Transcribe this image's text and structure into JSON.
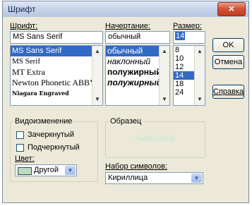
{
  "window": {
    "title": "Шрифт",
    "close_glyph": "×"
  },
  "font": {
    "label": "Шрифт:",
    "value": "MS Sans Serif",
    "items": [
      "MS Sans Serif",
      "MS Serif",
      "MT Extra",
      "Newton Phonetic ABBY",
      "Niagara Engraved"
    ],
    "selected_index": 0
  },
  "style": {
    "label": "Начертание:",
    "value": "обычный",
    "items": [
      "обычный",
      "наклонный",
      "полужирный",
      "полужирный"
    ],
    "selected_index": 0
  },
  "size": {
    "label": "Размер:",
    "value": "14",
    "items": [
      "8",
      "10",
      "12",
      "14",
      "18",
      "24"
    ],
    "selected_index": 3
  },
  "buttons": {
    "ok": "OK",
    "cancel": "Отмена",
    "help": "Справка"
  },
  "effects": {
    "label": "Видоизменение",
    "strikeout": "Зачеркнутый",
    "underline": "Подчеркнутый",
    "color_label": "Цвет:",
    "color_value": "Другой",
    "color_swatch": "#b9dcc4"
  },
  "sample": {
    "label": "Образец",
    "text": "AaBbЯяФф"
  },
  "charset": {
    "label": "Набор символов:",
    "value": "Кириллица"
  },
  "icons": {
    "scroll_up": "▲",
    "scroll_down": "▼",
    "dropdown": "▼"
  }
}
